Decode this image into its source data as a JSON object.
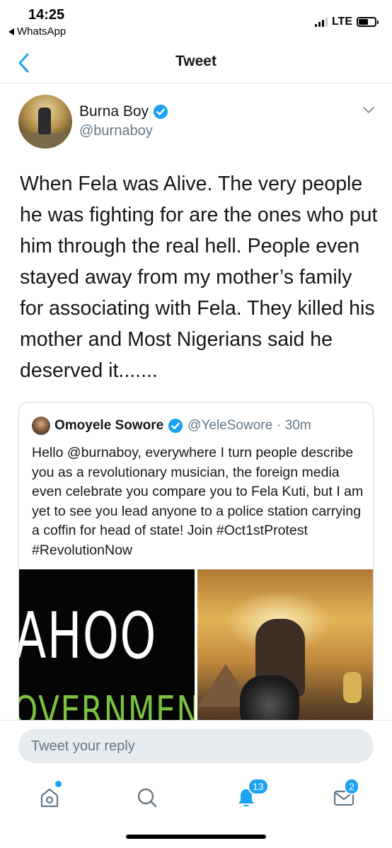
{
  "status_bar": {
    "time": "14:25",
    "back_app": "WhatsApp",
    "network": "LTE"
  },
  "nav": {
    "title": "Tweet"
  },
  "tweet": {
    "author_name": "Burna Boy",
    "author_handle": "@burnaboy",
    "verified": true,
    "text": "When Fela was Alive. The very people he was fighting for are the ones who put him through the real hell. People even stayed away from my mother’s family for associating with Fela. They killed his mother and Most Nigerians said he deserved it......."
  },
  "quoted_tweet": {
    "author_name": "Omoyele Sowore",
    "author_handle": "@YeleSowore",
    "time": "· 30m",
    "verified": true,
    "text": "Hello @burnaboy, everywhere I turn people describe you as a revolutionary musician, the foreign media even celebrate you compare you to Fela Kuti, but I am yet to see you lead anyone to a police station carrying a coffin for head of state! Join #Oct1stProtest #RevolutionNow",
    "media_left_text_top": "AHOO",
    "media_left_text_bottom": "OVERNMEN"
  },
  "reply": {
    "placeholder": "Tweet your reply"
  },
  "tab_bar": {
    "notifications_count": "13",
    "messages_count": "2"
  },
  "colors": {
    "accent": "#1da1f2",
    "secondary_text": "#657786",
    "border": "#ccd6dd"
  }
}
